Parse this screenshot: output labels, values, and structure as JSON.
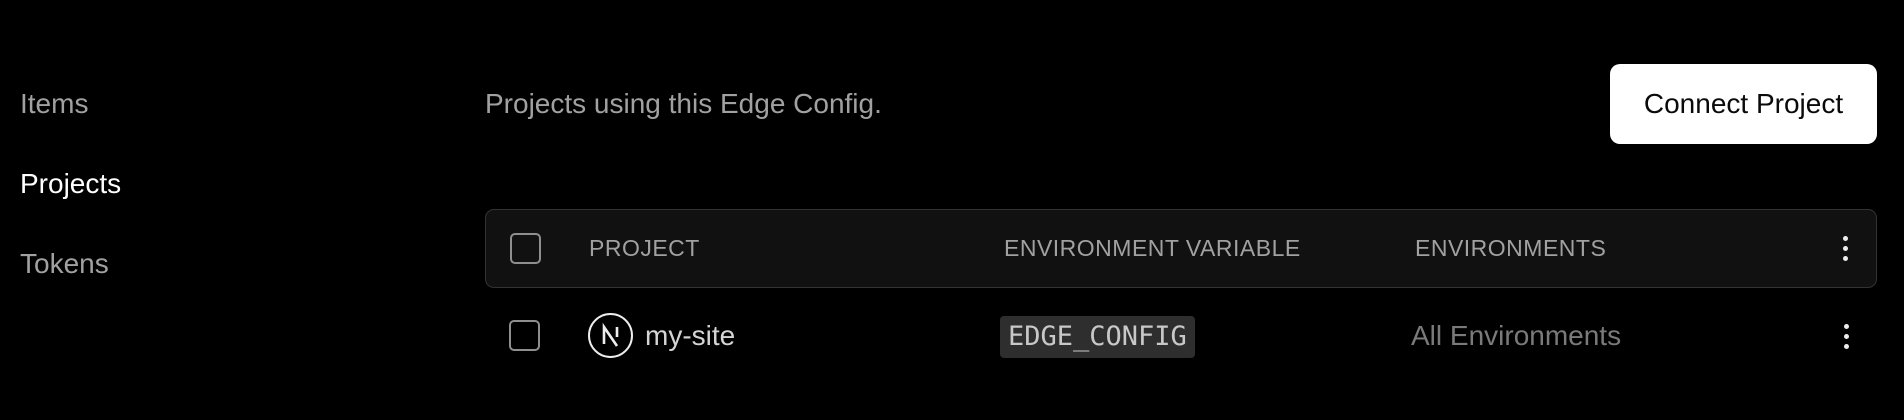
{
  "sidebar": {
    "items": [
      {
        "label": "Items",
        "active": false
      },
      {
        "label": "Projects",
        "active": true
      },
      {
        "label": "Tokens",
        "active": false
      }
    ]
  },
  "header": {
    "description": "Projects using this Edge Config.",
    "connect_button": "Connect Project"
  },
  "table": {
    "columns": [
      "PROJECT",
      "ENVIRONMENT VARIABLE",
      "ENVIRONMENTS"
    ],
    "rows": [
      {
        "project": "my-site",
        "project_icon": "nextjs-logo-icon",
        "env_variable": "EDGE_CONFIG",
        "environments": "All Environments"
      }
    ]
  },
  "colors": {
    "background": "#000000",
    "primary_button_bg": "#ffffff",
    "muted_text": "#a1a1a1",
    "table_header_bg": "#111111",
    "border": "#333333",
    "code_bg": "#2e2e2e"
  }
}
